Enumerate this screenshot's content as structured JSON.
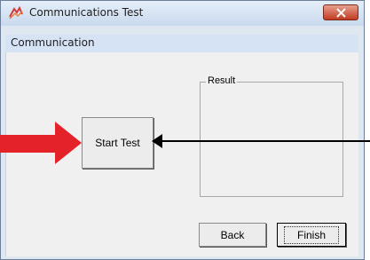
{
  "window": {
    "title": "Communications Test"
  },
  "header": {
    "title": "Communication"
  },
  "content": {
    "start_label": "Start Test",
    "result_label": "Result",
    "back_label": "Back",
    "finish_label": "Finish"
  },
  "colors": {
    "red_arrow": "#e4222a",
    "black_arrow": "#000000"
  },
  "icons": {
    "app": "app-icon",
    "close": "close-icon"
  }
}
